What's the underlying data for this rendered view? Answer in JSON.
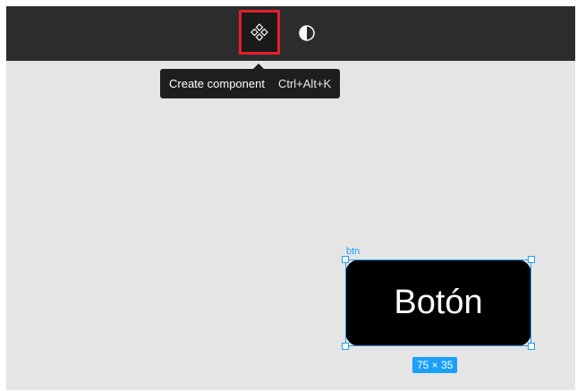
{
  "toolbar": {
    "create_component_icon": "component-icon",
    "contrast_icon": "contrast-icon"
  },
  "tooltip": {
    "label": "Create component",
    "shortcut": "Ctrl+Alt+K"
  },
  "canvas": {
    "frame_name": "btn",
    "button_text": "Botón",
    "dimensions": "75 × 35"
  },
  "colors": {
    "toolbar_bg": "#2c2c2c",
    "canvas_bg": "#e5e5e5",
    "selection": "#18a0fb",
    "highlight": "#e41f2b"
  }
}
